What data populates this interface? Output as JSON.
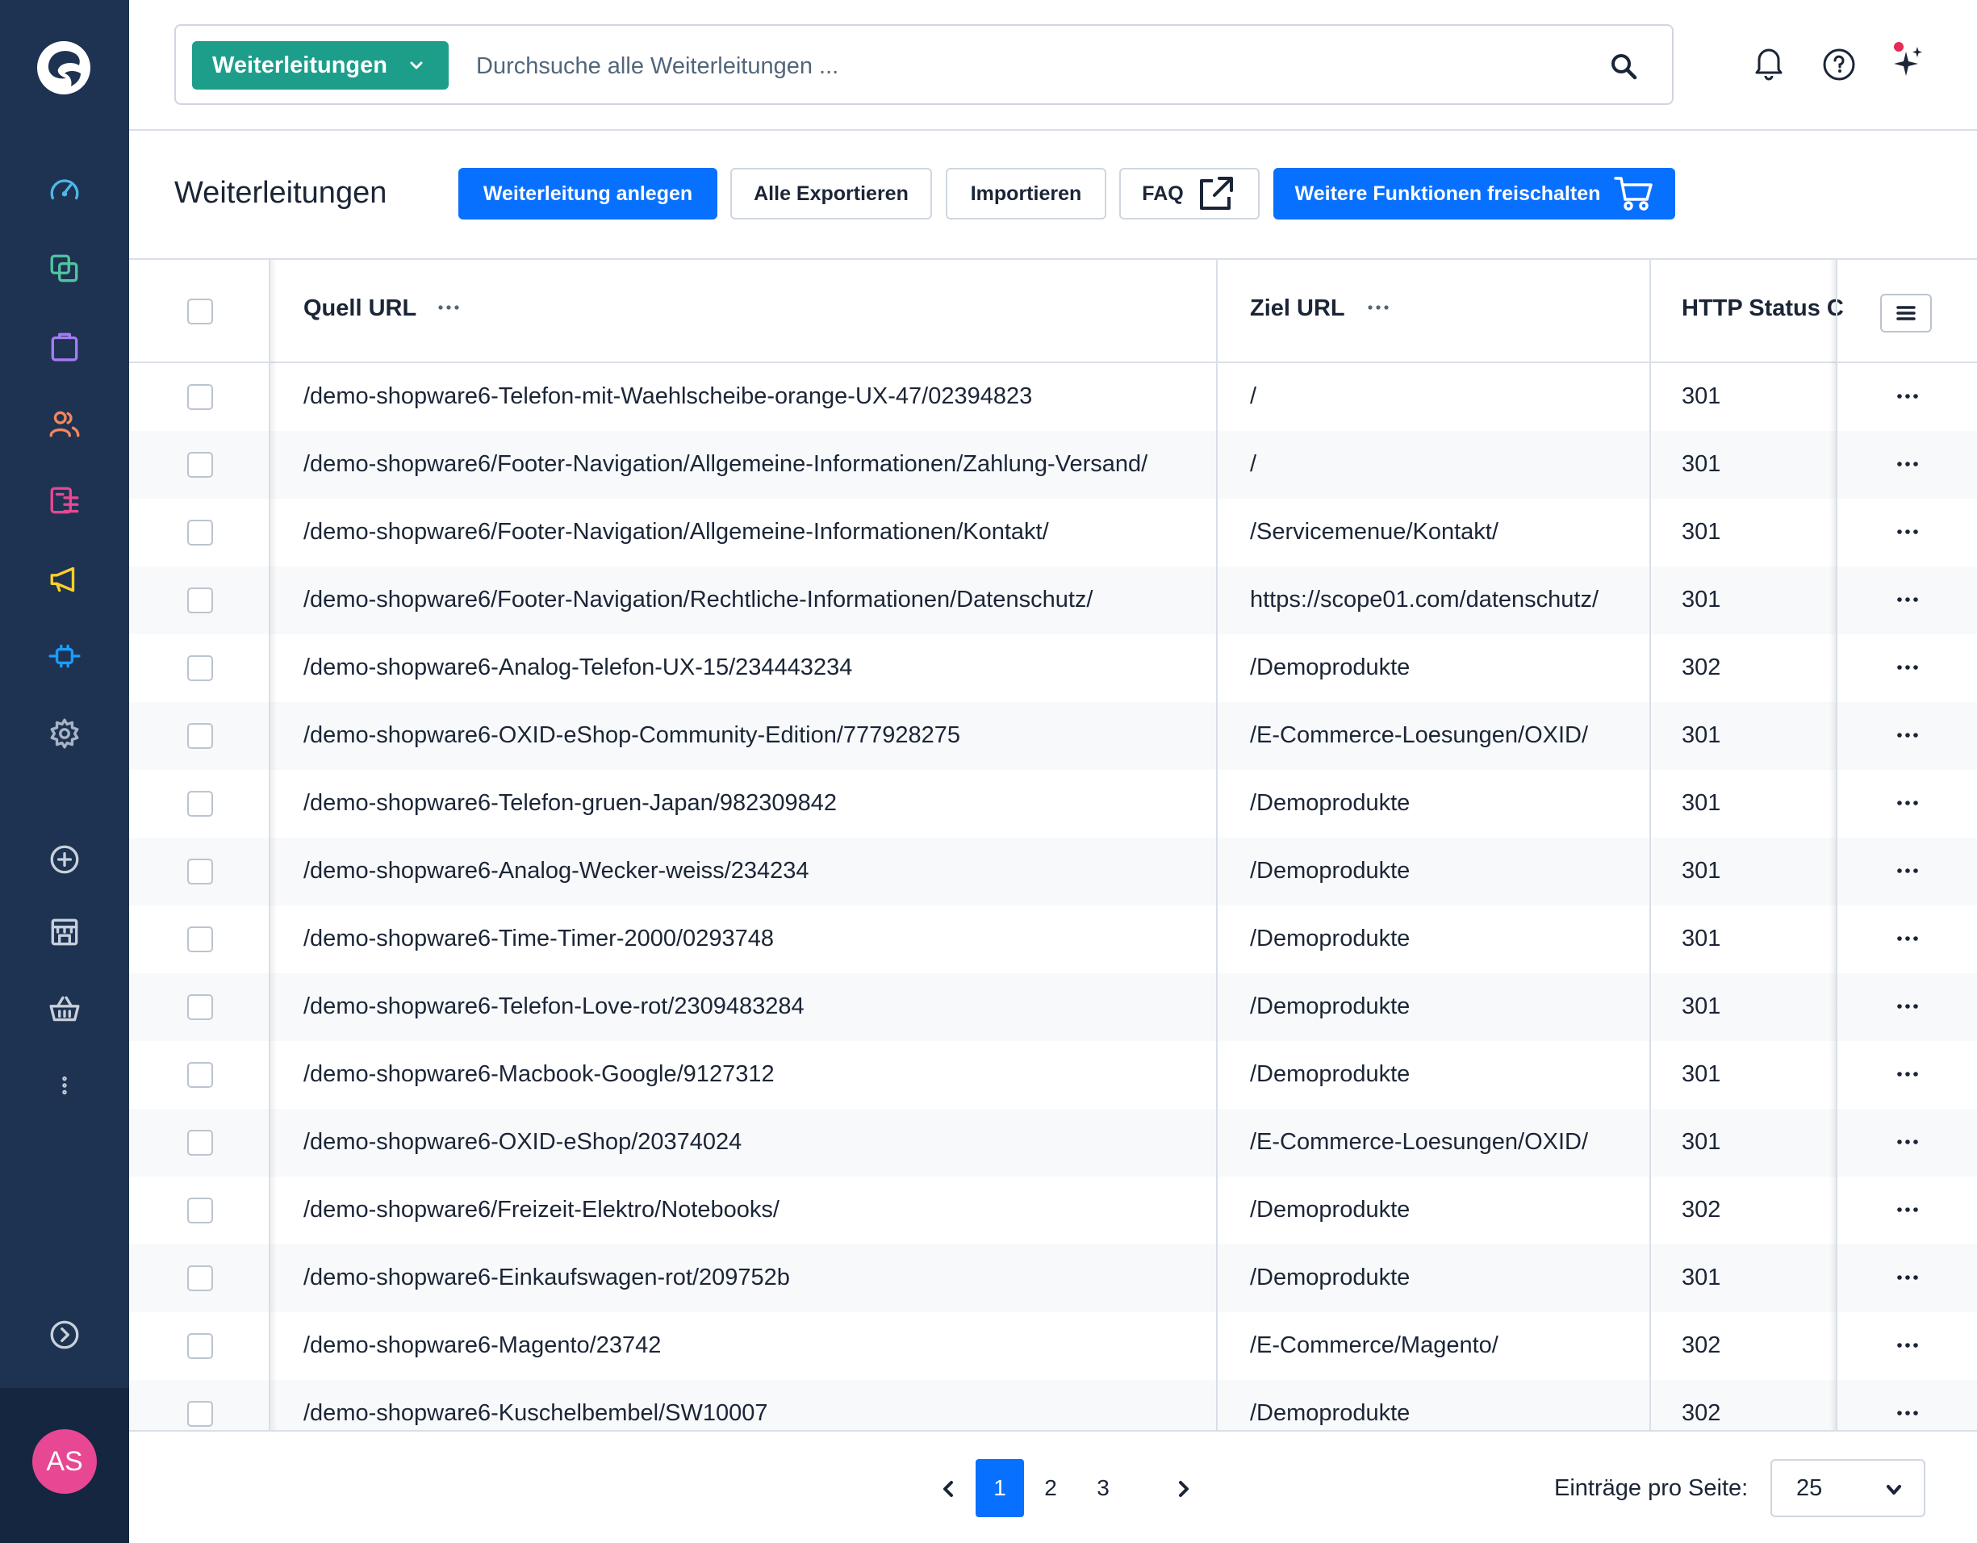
{
  "colors": {
    "sidebar": "#1e3352",
    "primary": "#0870ff",
    "teal": "#1d9e8a",
    "avatar": "#e74793",
    "notification": "#e52b56"
  },
  "sidebar": {
    "items": [
      {
        "icon": "dashboard-icon",
        "color": "#4db8e8"
      },
      {
        "icon": "catalogue-icon",
        "color": "#52c4a0"
      },
      {
        "icon": "orders-icon",
        "color": "#a57bf2"
      },
      {
        "icon": "customers-icon",
        "color": "#f5855b"
      },
      {
        "icon": "content-icon",
        "color": "#e74793"
      },
      {
        "icon": "marketing-icon",
        "color": "#ffd028"
      },
      {
        "icon": "extensions-icon",
        "color": "#189eff"
      },
      {
        "icon": "settings-icon",
        "color": "#a8b4c4"
      },
      {
        "icon": "add-sales-channel-icon",
        "color": "#c8d0da"
      },
      {
        "icon": "storefront-icon",
        "color": "#c8d0da"
      },
      {
        "icon": "headless-basket-icon",
        "color": "#c8d0da"
      },
      {
        "icon": "more-icon",
        "color": "#c8d0da"
      },
      {
        "icon": "expand-sidebar-icon",
        "color": "#c8d0da"
      }
    ],
    "avatar": "AS"
  },
  "search": {
    "type_label": "Weiterleitungen",
    "placeholder": "Durchsuche alle Weiterleitungen ..."
  },
  "toolbar": {
    "title": "Weiterleitungen",
    "create_label": "Weiterleitung anlegen",
    "export_label": "Alle Exportieren",
    "import_label": "Importieren",
    "faq_label": "FAQ",
    "unlock_label": "Weitere Funktionen freischalten"
  },
  "table": {
    "headers": {
      "source": "Quell URL",
      "target": "Ziel URL",
      "status": "HTTP Status C"
    },
    "rows": [
      {
        "source": "/demo-shopware6-Telefon-mit-Waehlscheibe-orange-UX-47/02394823",
        "target": "/",
        "status": "301"
      },
      {
        "source": "/demo-shopware6/Footer-Navigation/Allgemeine-Informationen/Zahlung-Versand/",
        "target": "/",
        "status": "301"
      },
      {
        "source": "/demo-shopware6/Footer-Navigation/Allgemeine-Informationen/Kontakt/",
        "target": "/Servicemenue/Kontakt/",
        "status": "301"
      },
      {
        "source": "/demo-shopware6/Footer-Navigation/Rechtliche-Informationen/Datenschutz/",
        "target": "https://scope01.com/datenschutz/",
        "status": "301"
      },
      {
        "source": "/demo-shopware6-Analog-Telefon-UX-15/234443234",
        "target": "/Demoprodukte",
        "status": "302"
      },
      {
        "source": "/demo-shopware6-OXID-eShop-Community-Edition/777928275",
        "target": "/E-Commerce-Loesungen/OXID/",
        "status": "301"
      },
      {
        "source": "/demo-shopware6-Telefon-gruen-Japan/982309842",
        "target": "/Demoprodukte",
        "status": "301"
      },
      {
        "source": "/demo-shopware6-Analog-Wecker-weiss/234234",
        "target": "/Demoprodukte",
        "status": "301"
      },
      {
        "source": "/demo-shopware6-Time-Timer-2000/0293748",
        "target": "/Demoprodukte",
        "status": "301"
      },
      {
        "source": "/demo-shopware6-Telefon-Love-rot/2309483284",
        "target": "/Demoprodukte",
        "status": "301"
      },
      {
        "source": "/demo-shopware6-Macbook-Google/9127312",
        "target": "/Demoprodukte",
        "status": "301"
      },
      {
        "source": "/demo-shopware6-OXID-eShop/20374024",
        "target": "/E-Commerce-Loesungen/OXID/",
        "status": "301"
      },
      {
        "source": "/demo-shopware6/Freizeit-Elektro/Notebooks/",
        "target": "/Demoprodukte",
        "status": "302"
      },
      {
        "source": "/demo-shopware6-Einkaufswagen-rot/209752b",
        "target": "/Demoprodukte",
        "status": "301"
      },
      {
        "source": "/demo-shopware6-Magento/23742",
        "target": "/E-Commerce/Magento/",
        "status": "302"
      },
      {
        "source": "/demo-shopware6-Kuschelbembel/SW10007",
        "target": "/Demoprodukte",
        "status": "302"
      }
    ]
  },
  "pagination": {
    "pages": [
      "1",
      "2",
      "3"
    ],
    "current": "1",
    "per_page_label": "Einträge pro Seite:",
    "per_page_value": "25"
  }
}
